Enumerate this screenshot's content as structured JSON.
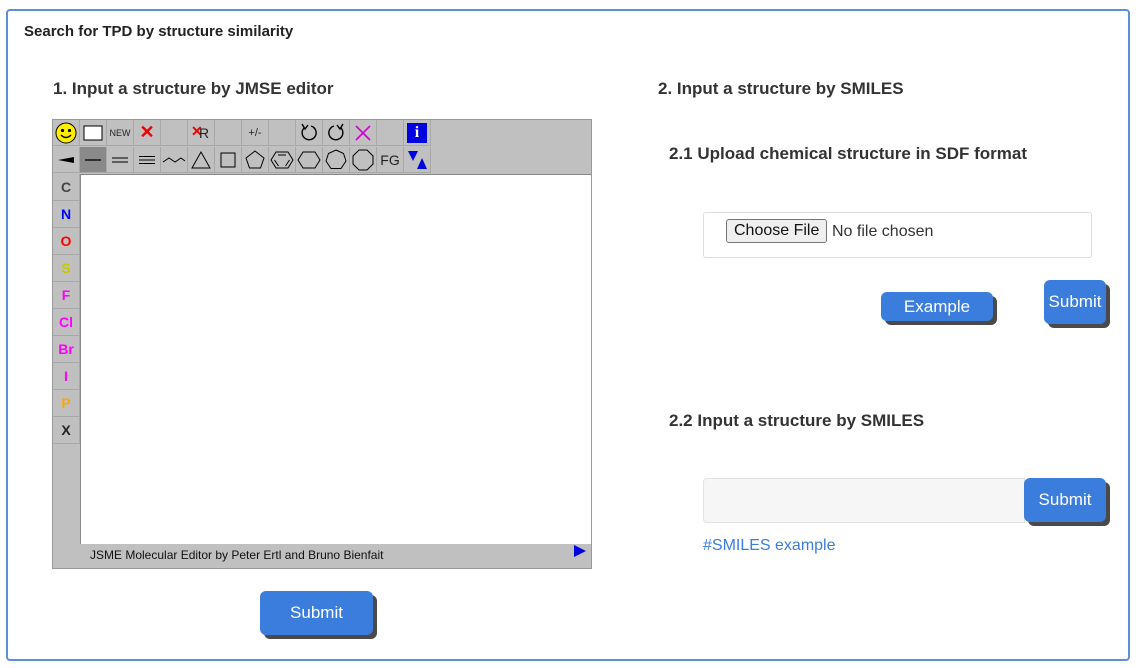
{
  "panel": {
    "title": "Search for TPD by structure similarity"
  },
  "section1": {
    "heading": "1. Input a structure by JMSE editor",
    "editor": {
      "toolbar_row1": [
        {
          "name": "smiley-icon",
          "label": ""
        },
        {
          "name": "clear-icon",
          "label": ""
        },
        {
          "name": "new-button",
          "label": "NEW"
        },
        {
          "name": "delete-icon",
          "label": "✕"
        },
        {
          "name": "blank",
          "label": ""
        },
        {
          "name": "delete-r-icon",
          "label": "R"
        },
        {
          "name": "blank",
          "label": ""
        },
        {
          "name": "charge-icon",
          "label": "+/-"
        },
        {
          "name": "blank",
          "label": ""
        },
        {
          "name": "undo-icon",
          "label": ""
        },
        {
          "name": "redo-icon",
          "label": ""
        },
        {
          "name": "mark-icon",
          "label": ""
        },
        {
          "name": "blank",
          "label": ""
        },
        {
          "name": "info-icon",
          "label": "i"
        }
      ],
      "toolbar_row2": [
        {
          "name": "wedge-bond-icon"
        },
        {
          "name": "single-bond-icon"
        },
        {
          "name": "double-bond-icon"
        },
        {
          "name": "triple-bond-icon"
        },
        {
          "name": "chain-icon"
        },
        {
          "name": "triangle-ring-icon"
        },
        {
          "name": "square-ring-icon"
        },
        {
          "name": "pentagon-ring-icon"
        },
        {
          "name": "benzene-ring-icon"
        },
        {
          "name": "hexagon-ring-icon"
        },
        {
          "name": "heptagon-ring-icon"
        },
        {
          "name": "octagon-ring-icon"
        },
        {
          "name": "fg-button",
          "label": "FG"
        },
        {
          "name": "flip-icon"
        }
      ],
      "atoms": [
        {
          "label": "C",
          "color": "#444444"
        },
        {
          "label": "N",
          "color": "#0000ff"
        },
        {
          "label": "O",
          "color": "#ff0000"
        },
        {
          "label": "S",
          "color": "#c8c800"
        },
        {
          "label": "F",
          "color": "#ff00ff"
        },
        {
          "label": "Cl",
          "color": "#ff00ff"
        },
        {
          "label": "Br",
          "color": "#ff00ff"
        },
        {
          "label": "I",
          "color": "#ff00ff"
        },
        {
          "label": "P",
          "color": "#ffa500"
        },
        {
          "label": "X",
          "color": "#222222"
        }
      ],
      "footer": "JSME Molecular Editor by Peter Ertl and Bruno Bienfait"
    },
    "submit_label": "Submit"
  },
  "section2": {
    "heading": "2. Input a structure by SMILES",
    "upload": {
      "heading": "2.1 Upload chemical structure in SDF format",
      "choose_label": "Choose File",
      "no_file_label": "No file chosen",
      "example_label": "Example",
      "submit_label": "Submit"
    },
    "smiles": {
      "heading": "2.2 Input a structure by SMILES",
      "input_value": "",
      "submit_label": "Submit",
      "example_link": "#SMILES example"
    }
  },
  "colors": {
    "accent": "#3b7ddd",
    "border": "#5b8fd6"
  }
}
